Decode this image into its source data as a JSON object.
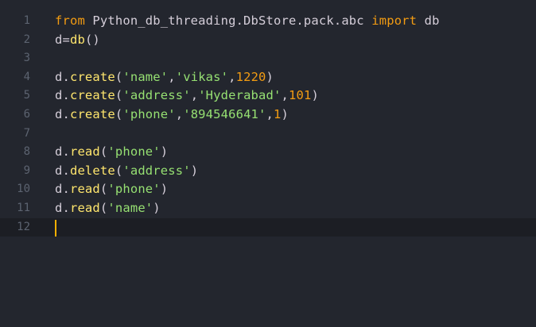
{
  "theme": {
    "background": "#23262e",
    "active_line_background": "#1c1e24",
    "line_number": "#5c6370",
    "text": "#d5ced9",
    "keyword": "#f39c12",
    "method": "#ffe66d",
    "string": "#96e072",
    "number": "#f39c12",
    "cursor": "#ffb000"
  },
  "editor": {
    "active_line": 12,
    "lines": [
      {
        "number": "1",
        "tokens": [
          {
            "text": "from",
            "type": "keyword"
          },
          {
            "text": " Python_db_threading.DbStore.pack.abc ",
            "type": "text"
          },
          {
            "text": "import",
            "type": "keyword"
          },
          {
            "text": " db",
            "type": "text"
          }
        ]
      },
      {
        "number": "2",
        "tokens": [
          {
            "text": "d=",
            "type": "text"
          },
          {
            "text": "db",
            "type": "method"
          },
          {
            "text": "()",
            "type": "text"
          }
        ]
      },
      {
        "number": "3",
        "tokens": []
      },
      {
        "number": "4",
        "tokens": [
          {
            "text": "d.",
            "type": "text"
          },
          {
            "text": "create",
            "type": "method"
          },
          {
            "text": "(",
            "type": "text"
          },
          {
            "text": "'name'",
            "type": "string"
          },
          {
            "text": ",",
            "type": "text"
          },
          {
            "text": "'vikas'",
            "type": "string"
          },
          {
            "text": ",",
            "type": "text"
          },
          {
            "text": "1220",
            "type": "number"
          },
          {
            "text": ")",
            "type": "text"
          }
        ]
      },
      {
        "number": "5",
        "tokens": [
          {
            "text": "d.",
            "type": "text"
          },
          {
            "text": "create",
            "type": "method"
          },
          {
            "text": "(",
            "type": "text"
          },
          {
            "text": "'address'",
            "type": "string"
          },
          {
            "text": ",",
            "type": "text"
          },
          {
            "text": "'Hyderabad'",
            "type": "string"
          },
          {
            "text": ",",
            "type": "text"
          },
          {
            "text": "101",
            "type": "number"
          },
          {
            "text": ")",
            "type": "text"
          }
        ]
      },
      {
        "number": "6",
        "tokens": [
          {
            "text": "d.",
            "type": "text"
          },
          {
            "text": "create",
            "type": "method"
          },
          {
            "text": "(",
            "type": "text"
          },
          {
            "text": "'phone'",
            "type": "string"
          },
          {
            "text": ",",
            "type": "text"
          },
          {
            "text": "'894546641'",
            "type": "string"
          },
          {
            "text": ",",
            "type": "text"
          },
          {
            "text": "1",
            "type": "number"
          },
          {
            "text": ")",
            "type": "text"
          }
        ]
      },
      {
        "number": "7",
        "tokens": []
      },
      {
        "number": "8",
        "tokens": [
          {
            "text": "d.",
            "type": "text"
          },
          {
            "text": "read",
            "type": "method"
          },
          {
            "text": "(",
            "type": "text"
          },
          {
            "text": "'phone'",
            "type": "string"
          },
          {
            "text": ")",
            "type": "text"
          }
        ]
      },
      {
        "number": "9",
        "tokens": [
          {
            "text": "d.",
            "type": "text"
          },
          {
            "text": "delete",
            "type": "method"
          },
          {
            "text": "(",
            "type": "text"
          },
          {
            "text": "'address'",
            "type": "string"
          },
          {
            "text": ")",
            "type": "text"
          }
        ]
      },
      {
        "number": "10",
        "tokens": [
          {
            "text": "d.",
            "type": "text"
          },
          {
            "text": "read",
            "type": "method"
          },
          {
            "text": "(",
            "type": "text"
          },
          {
            "text": "'phone'",
            "type": "string"
          },
          {
            "text": ")",
            "type": "text"
          }
        ]
      },
      {
        "number": "11",
        "tokens": [
          {
            "text": "d.",
            "type": "text"
          },
          {
            "text": "read",
            "type": "method"
          },
          {
            "text": "(",
            "type": "text"
          },
          {
            "text": "'name'",
            "type": "string"
          },
          {
            "text": ")",
            "type": "text"
          }
        ]
      },
      {
        "number": "12",
        "tokens": []
      }
    ]
  }
}
